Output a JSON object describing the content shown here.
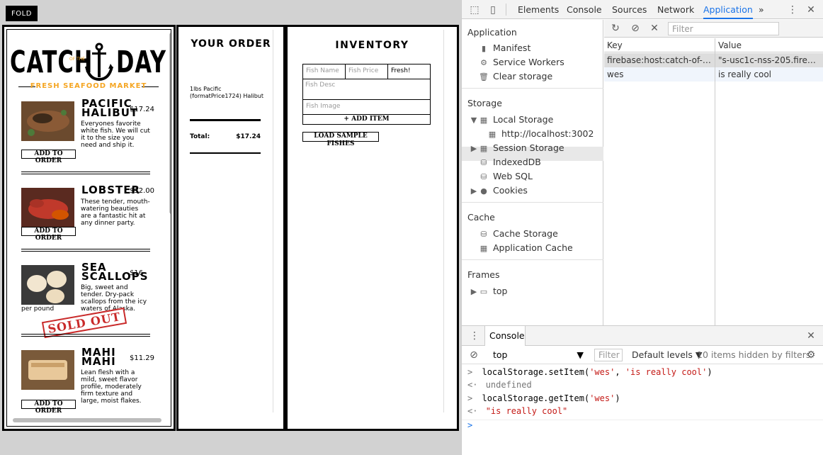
{
  "app": {
    "fold_label": "FOLD",
    "logo": {
      "word1": "CATCH",
      "ofthe": "OF THE",
      "word2": "DAY",
      "subtitle": "FRESH SEAFOOD MARKET"
    },
    "fishes": [
      {
        "name": "PACIFIC HALIBUT",
        "price": "$17.24",
        "desc": "Everyones favorite white fish. We will cut it to the size you need and ship it.",
        "button": "ADD TO ORDER"
      },
      {
        "name": "LOBSTER",
        "price": "$32.00",
        "desc": "These tender, mouth-watering beauties are a fantastic hit at any dinner party.",
        "button": "ADD TO ORDER"
      },
      {
        "name": "SEA SCALLOPS",
        "price": "$16",
        "desc": "Big, sweet and tender. Dry-pack scallops from the icy waters of Alaska.",
        "desc_tail": "per pound",
        "sold_out": "SOLD OUT"
      },
      {
        "name": "MAHI MAHI",
        "price": "$11.29",
        "desc": "Lean flesh with a mild, sweet flavor profile, moderately firm texture and large, moist flakes.",
        "button": "ADD TO ORDER"
      }
    ],
    "order": {
      "title": "YOUR ORDER",
      "item": "1lbs Pacific (formatPrice1724) Halibut",
      "total_label": "Total:",
      "total_value": "$17.24"
    },
    "inventory": {
      "title": "INVENTORY",
      "name_placeholder": "Fish Name",
      "price_placeholder": "Fish Price",
      "status_value": "Fresh!",
      "desc_placeholder": "Fish Desc",
      "image_placeholder": "Fish Image",
      "add_label": "+ ADD ITEM",
      "load_label": "LOAD SAMPLE FISHES"
    }
  },
  "devtools": {
    "tabs": [
      "Elements",
      "Console",
      "Sources",
      "Network",
      "Application"
    ],
    "active_tab": "Application",
    "more": "»",
    "sidebar": {
      "application_header": "Application",
      "app_items": [
        "Manifest",
        "Service Workers",
        "Clear storage"
      ],
      "storage_header": "Storage",
      "local_storage": "Local Storage",
      "local_child": "http://localhost:3002",
      "session_storage": "Session Storage",
      "indexeddb": "IndexedDB",
      "websql": "Web SQL",
      "cookies": "Cookies",
      "cache_header": "Cache",
      "cache_storage": "Cache Storage",
      "app_cache": "Application Cache",
      "frames_header": "Frames",
      "frame_top": "top"
    },
    "table": {
      "filter_placeholder": "Filter",
      "col_key": "Key",
      "col_value": "Value",
      "rows": [
        {
          "key": "firebase:host:catch-of-th...",
          "value": "\"s-usc1c-nss-205.fireba..."
        },
        {
          "key": "wes",
          "value": "is really cool"
        }
      ]
    },
    "console": {
      "tab": "Console",
      "context": "top",
      "filter_placeholder": "Filter",
      "levels": "Default levels ▼",
      "hidden": "10 items hidden by filters",
      "lines": [
        {
          "prefix": ">",
          "code": "localStorage.setItem(",
          "a": "'wes'",
          "mid": ", ",
          "b": "'is really cool'",
          "end": ")"
        },
        {
          "prefix": "<·",
          "result": "undefined"
        },
        {
          "prefix": ">",
          "code": "localStorage.getItem(",
          "a": "'wes'",
          "end": ")"
        },
        {
          "prefix": "<·",
          "result": "\"is really cool\""
        }
      ],
      "prompt": ">"
    }
  }
}
